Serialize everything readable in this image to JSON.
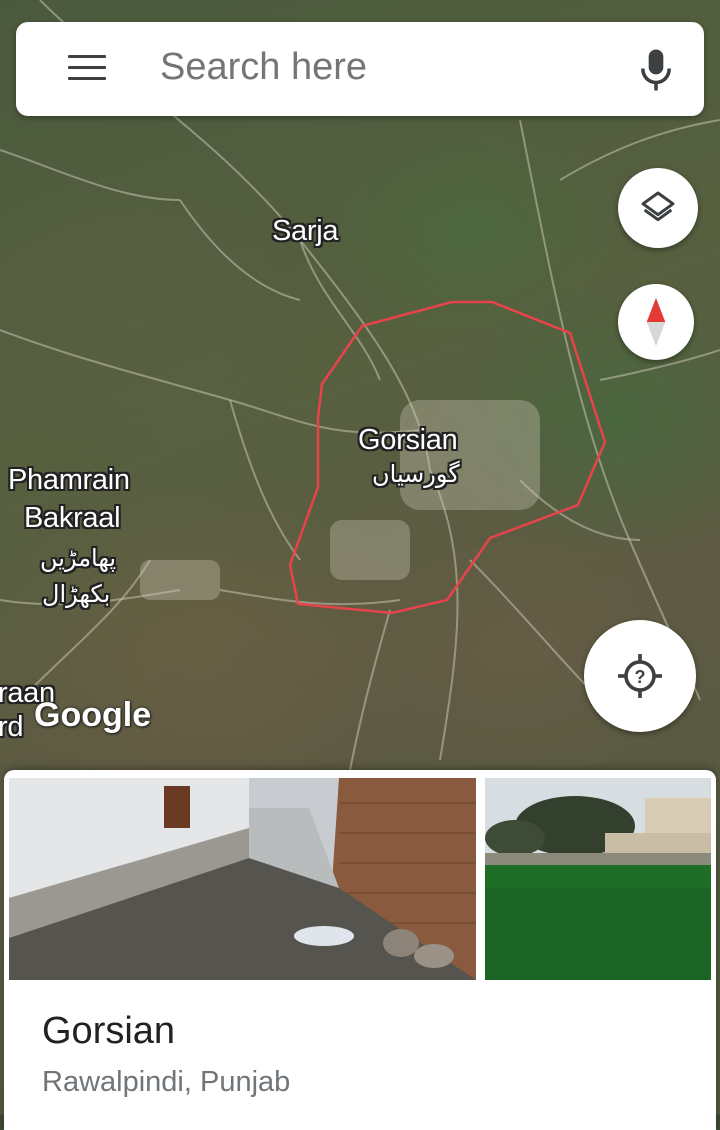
{
  "search": {
    "placeholder": "Search here",
    "menu_icon": "menu-icon",
    "mic_icon": "microphone-icon"
  },
  "map": {
    "labels": {
      "sarja": "Sarja",
      "gorsian": "Gorsian",
      "gorsian_urdu": "گورسیاں",
      "phamrain": "Phamrain",
      "bakraal": "Bakraal",
      "phamrain_urdu": "پھامڑیں",
      "bakraal_urdu": "بکھڑال",
      "cut_line1": "raan",
      "cut_line2": "rd"
    },
    "logo": "Google",
    "boundary_color": "#e8434a",
    "controls": {
      "layers_icon": "layers-icon",
      "compass_icon": "compass-icon",
      "locate_icon": "my-location-icon"
    }
  },
  "place": {
    "title": "Gorsian",
    "subtitle": "Rawalpindi, Punjab",
    "photos": [
      "street-photo",
      "field-photo"
    ]
  }
}
